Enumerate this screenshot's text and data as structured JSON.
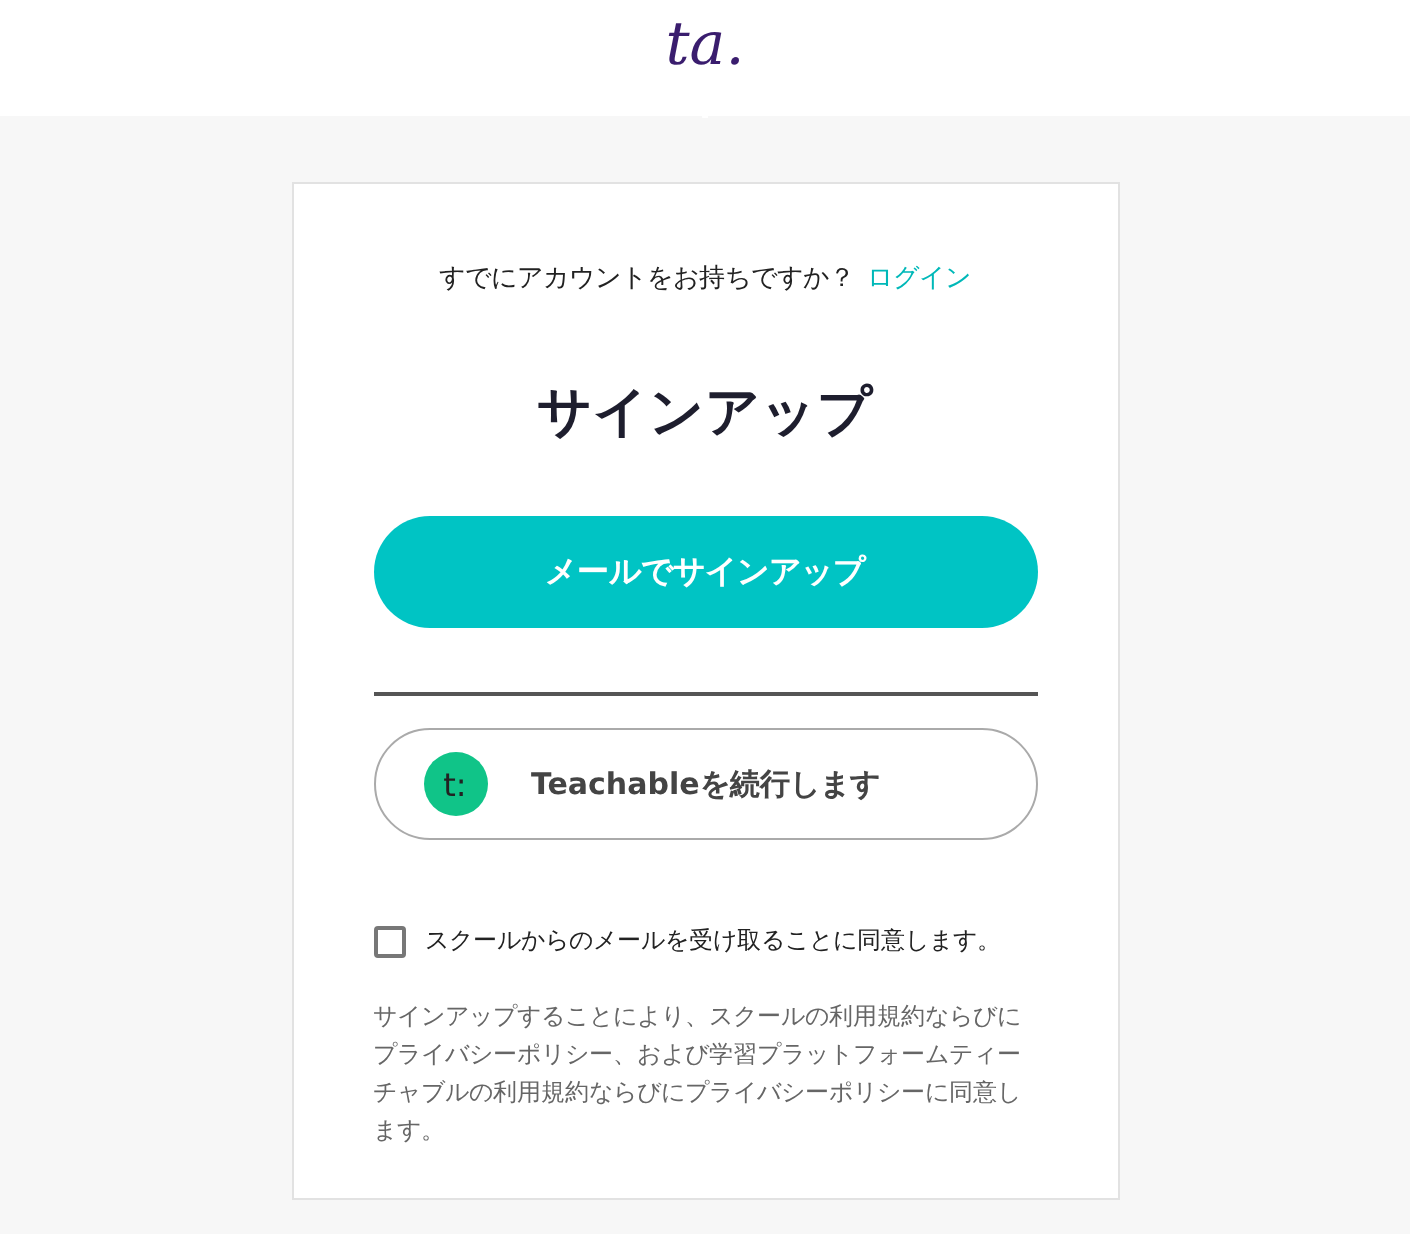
{
  "logo": {
    "text": "ta."
  },
  "login_prompt": {
    "text": "すでにアカウントをお持ちですか？",
    "link": "ログイン"
  },
  "heading": "サインアップ",
  "email_button": "メールでサインアップ",
  "teachable_button": {
    "icon_text": "t:",
    "label": "Teachableを続行します"
  },
  "consent": {
    "label": "スクールからのメールを受け取ることに同意します。",
    "checked": false
  },
  "legal": "サインアップすることにより、スクールの利用規約ならびにプライバシーポリシー、および学習プラットフォームティーチャブルの利用規約ならびにプライバシーポリシーに同意します。"
}
